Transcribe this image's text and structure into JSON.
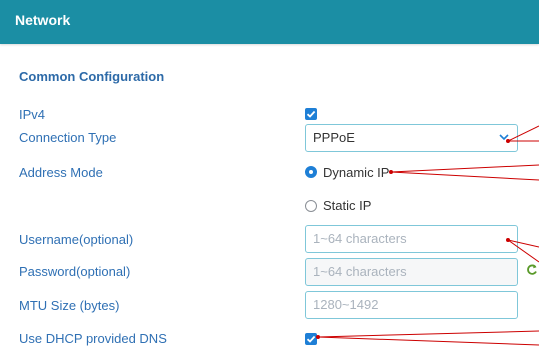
{
  "header": {
    "title": "Network"
  },
  "section": {
    "title": "Common Configuration"
  },
  "fields": {
    "ipv4": {
      "label": "IPv4",
      "checked": true
    },
    "connection_type": {
      "label": "Connection Type",
      "value": "PPPoE"
    },
    "address_mode": {
      "label": "Address Mode",
      "option_dynamic": "Dynamic IP",
      "option_static": "Static IP",
      "selected": "Dynamic IP"
    },
    "username": {
      "label": "Username(optional)",
      "placeholder": "1~64 characters"
    },
    "password": {
      "label": "Password(optional)",
      "placeholder": "1~64 characters"
    },
    "mtu": {
      "label": "MTU Size (bytes)",
      "placeholder": "1280~1492"
    },
    "use_dhcp_dns": {
      "label": "Use DHCP provided DNS",
      "checked": true
    }
  },
  "icons": {
    "checkbox": "check-icon",
    "dropdown": "chevron-down-icon",
    "password_refresh": "refresh-icon"
  },
  "colors": {
    "header": "#1b8ea4",
    "label": "#2f70b4",
    "accent": "#1e7fd6",
    "field_border": "#7fc7d9",
    "annotation": "#cc0000"
  }
}
